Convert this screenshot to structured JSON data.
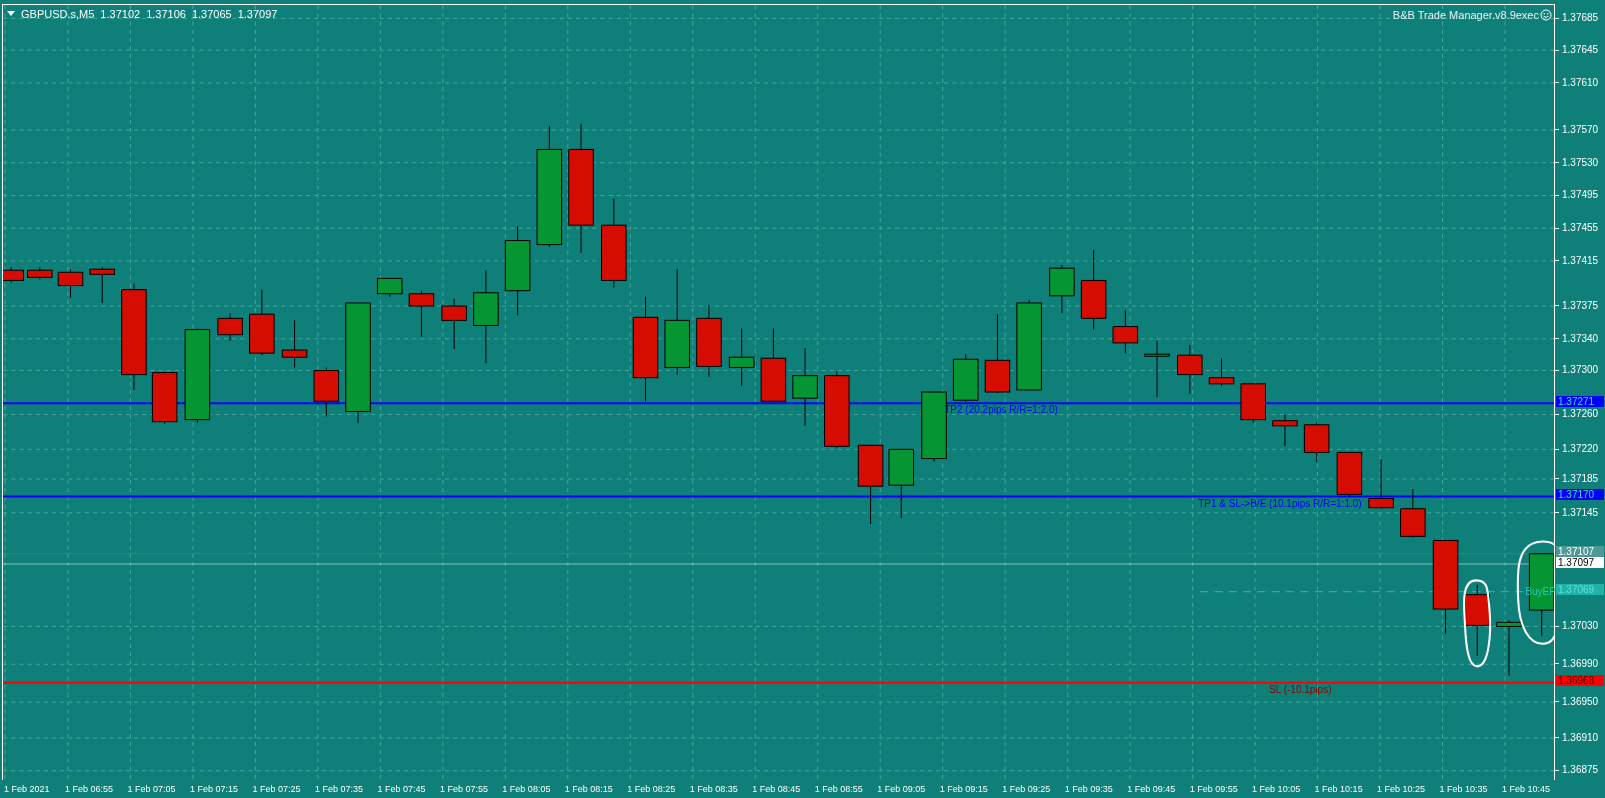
{
  "header": {
    "symbol": "GBPUSD.s,M5",
    "quotes": [
      "1.37102",
      "1.37106",
      "1.37065",
      "1.37097"
    ]
  },
  "indicator": {
    "title": "B&B Trade Manager.v8.9exec"
  },
  "levels": [
    {
      "kind": "solid",
      "label": "TP2 (20.2pips R/R=1:2.0)",
      "price": "1.37271",
      "color": "#0000ff"
    },
    {
      "kind": "solid",
      "label": "TP1 & SL->B/E (10.1pips R/R=1:1.0)",
      "price": "1.37170",
      "color": "#0000ff"
    },
    {
      "kind": "thin",
      "price": "1.37107",
      "color": "#4f9994"
    },
    {
      "kind": "thin",
      "price": "1.37097",
      "color": "#ffffff"
    },
    {
      "kind": "dashed",
      "label": "BuyEP",
      "price": "1.37069",
      "color": "#20b2aa"
    },
    {
      "kind": "solid",
      "label": "SL (-10.1pips)",
      "price": "1.36968",
      "color": "#ff0000"
    }
  ],
  "price_axis": [
    "1.37685",
    "1.37645",
    "1.37610",
    "1.37570",
    "1.37530",
    "1.37495",
    "1.37455",
    "1.37415",
    "1.37375",
    "1.37340",
    "1.37300",
    "1.37260",
    "1.37220",
    "1.37185",
    "1.37145",
    "1.37030",
    "1.36990",
    "1.36950",
    "1.36910",
    "1.36875"
  ],
  "time_axis": [
    "1 Feb 2021",
    "1 Feb 06:55",
    "1 Feb 07:05",
    "1 Feb 07:15",
    "1 Feb 07:25",
    "1 Feb 07:35",
    "1 Feb 07:45",
    "1 Feb 07:55",
    "1 Feb 08:05",
    "1 Feb 08:15",
    "1 Feb 08:25",
    "1 Feb 08:35",
    "1 Feb 08:45",
    "1 Feb 08:55",
    "1 Feb 09:05",
    "1 Feb 09:15",
    "1 Feb 09:25",
    "1 Feb 09:35",
    "1 Feb 09:45",
    "1 Feb 09:55",
    "1 Feb 10:05",
    "1 Feb 10:15",
    "1 Feb 10:25",
    "1 Feb 10:35",
    "1 Feb 10:45"
  ]
}
